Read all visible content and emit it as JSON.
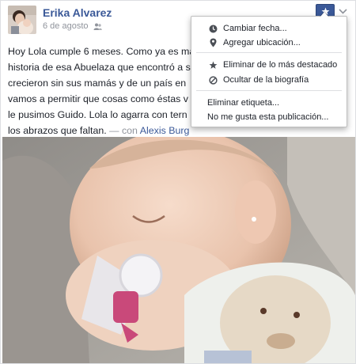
{
  "post": {
    "author": "Erika Alvarez",
    "date": "6 de agosto",
    "privacy_icon": "friends-icon",
    "text_lines": [
      "Hoy Lola cumple 6 meses. Como ya es mas",
      "historia de esa Abuelaza que encontró a s",
      "crecieron sin sus mamás y de un país en",
      "vamos a permitir que cosas como éstas v",
      "le pusimos Guido. Lola lo agarra con tern",
      "los abrazos que faltan."
    ],
    "tag_prefix": "— con",
    "tagged_person": "Alexis Burg"
  },
  "header_buttons": {
    "highlight_icon": "star-icon",
    "options_icon": "chevron-down-icon"
  },
  "menu": {
    "items": [
      {
        "label": "Cambiar fecha...",
        "icon": "clock-icon"
      },
      {
        "label": "Agregar ubicación...",
        "icon": "location-pin-icon"
      },
      {
        "label": "Eliminar de lo más destacado",
        "icon": "star-icon"
      },
      {
        "label": "Ocultar de la biografía",
        "icon": "hide-icon"
      },
      {
        "label": "Eliminar etiqueta...",
        "icon": ""
      },
      {
        "label": "No me gusta esta publicación...",
        "icon": ""
      }
    ]
  },
  "colors": {
    "brand": "#3b5998",
    "text": "#1d2129",
    "muted": "#90949c"
  }
}
